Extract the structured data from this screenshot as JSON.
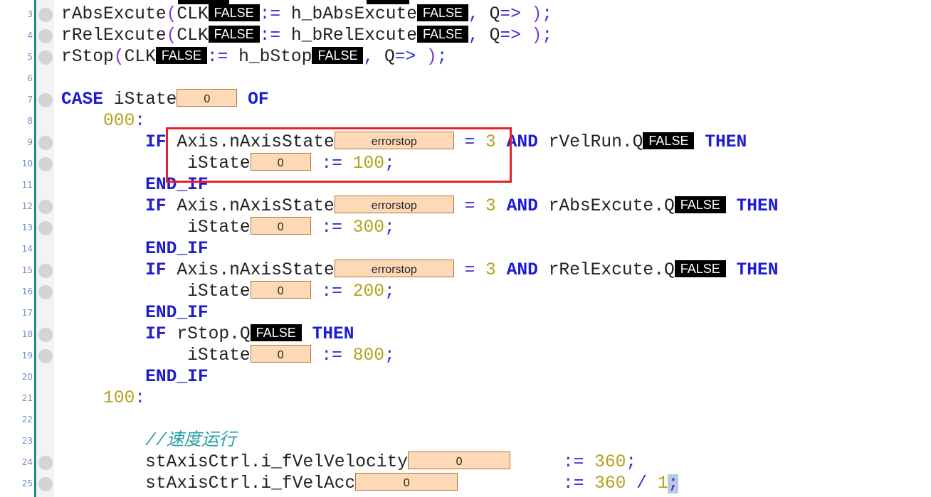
{
  "editor": {
    "colors": {
      "keyword": "#1c1cd0",
      "number": "#b5a21a",
      "comment": "#2a9fa6",
      "bool_monitor": "#000000",
      "value_monitor": "#fdd9b6",
      "highlight": "#e52129"
    },
    "highlight_lines": [
      9,
      10
    ],
    "lines": [
      {
        "n": "3",
        "bp": true,
        "seg": [
          [
            "id",
            "rAbsExcute"
          ],
          [
            "par",
            "("
          ],
          [
            "id",
            "CLK"
          ],
          [
            "mon-b",
            "FALSE"
          ],
          [
            "op",
            ":="
          ],
          [
            "id",
            " h_bAbsExcute"
          ],
          [
            "mon-b",
            "FALSE"
          ],
          [
            "op",
            ", "
          ],
          [
            "id",
            "Q"
          ],
          [
            "op",
            "=> "
          ],
          [
            "par",
            ")"
          ],
          [
            "op",
            ";"
          ]
        ]
      },
      {
        "n": "4",
        "bp": true,
        "seg": [
          [
            "id",
            "rRelExcute"
          ],
          [
            "par",
            "("
          ],
          [
            "id",
            "CLK"
          ],
          [
            "mon-b",
            "FALSE"
          ],
          [
            "op",
            ":="
          ],
          [
            "id",
            " h_bRelExcute"
          ],
          [
            "mon-b",
            "FALSE"
          ],
          [
            "op",
            ", "
          ],
          [
            "id",
            "Q"
          ],
          [
            "op",
            "=> "
          ],
          [
            "par",
            ")"
          ],
          [
            "op",
            ";"
          ]
        ]
      },
      {
        "n": "5",
        "bp": true,
        "seg": [
          [
            "id",
            "rStop"
          ],
          [
            "par",
            "("
          ],
          [
            "id",
            "CLK"
          ],
          [
            "mon-b",
            "FALSE"
          ],
          [
            "op",
            ":="
          ],
          [
            "id",
            " h_bStop"
          ],
          [
            "mon-b",
            "FALSE"
          ],
          [
            "op",
            ", "
          ],
          [
            "id",
            "Q"
          ],
          [
            "op",
            "=> "
          ],
          [
            "par",
            ")"
          ],
          [
            "op",
            ";"
          ]
        ]
      },
      {
        "n": "6",
        "bp": false,
        "seg": []
      },
      {
        "n": "7",
        "bp": true,
        "seg": [
          [
            "kw",
            "CASE"
          ],
          [
            "id",
            " iState"
          ],
          [
            "mon-v",
            "0"
          ],
          [
            "id",
            " "
          ],
          [
            "kw",
            "OF"
          ]
        ]
      },
      {
        "n": "8",
        "bp": false,
        "seg": [
          [
            "id",
            "    "
          ],
          [
            "num",
            "000"
          ],
          [
            "op",
            ":"
          ]
        ]
      },
      {
        "n": "9",
        "bp": true,
        "seg": [
          [
            "id",
            "        "
          ],
          [
            "kw",
            "IF"
          ],
          [
            "id",
            " Axis.nAxisState"
          ],
          [
            "mon-v",
            "errorstop"
          ],
          [
            "op",
            " = "
          ],
          [
            "num",
            "3"
          ],
          [
            "id",
            " "
          ],
          [
            "kw",
            "AND"
          ],
          [
            "id",
            " rVelRun.Q"
          ],
          [
            "mon-b",
            "FALSE"
          ],
          [
            "id",
            " "
          ],
          [
            "kw",
            "THEN"
          ]
        ]
      },
      {
        "n": "10",
        "bp": true,
        "seg": [
          [
            "id",
            "            iState"
          ],
          [
            "mon-v",
            "0"
          ],
          [
            "op",
            " := "
          ],
          [
            "num",
            "100"
          ],
          [
            "op",
            ";"
          ]
        ]
      },
      {
        "n": "11",
        "bp": false,
        "seg": [
          [
            "id",
            "        "
          ],
          [
            "kw",
            "END_IF"
          ]
        ]
      },
      {
        "n": "12",
        "bp": true,
        "seg": [
          [
            "id",
            "        "
          ],
          [
            "kw",
            "IF"
          ],
          [
            "id",
            " Axis.nAxisState"
          ],
          [
            "mon-v",
            "errorstop"
          ],
          [
            "op",
            " = "
          ],
          [
            "num",
            "3"
          ],
          [
            "id",
            " "
          ],
          [
            "kw",
            "AND"
          ],
          [
            "id",
            " rAbsExcute.Q"
          ],
          [
            "mon-b",
            "FALSE"
          ],
          [
            "id",
            " "
          ],
          [
            "kw",
            "THEN"
          ]
        ]
      },
      {
        "n": "13",
        "bp": true,
        "seg": [
          [
            "id",
            "            iState"
          ],
          [
            "mon-v",
            "0"
          ],
          [
            "op",
            " := "
          ],
          [
            "num",
            "300"
          ],
          [
            "op",
            ";"
          ]
        ]
      },
      {
        "n": "14",
        "bp": false,
        "seg": [
          [
            "id",
            "        "
          ],
          [
            "kw",
            "END_IF"
          ]
        ]
      },
      {
        "n": "15",
        "bp": true,
        "seg": [
          [
            "id",
            "        "
          ],
          [
            "kw",
            "IF"
          ],
          [
            "id",
            " Axis.nAxisState"
          ],
          [
            "mon-v",
            "errorstop"
          ],
          [
            "op",
            " = "
          ],
          [
            "num",
            "3"
          ],
          [
            "id",
            " "
          ],
          [
            "kw",
            "AND"
          ],
          [
            "id",
            " rRelExcute.Q"
          ],
          [
            "mon-b",
            "FALSE"
          ],
          [
            "id",
            " "
          ],
          [
            "kw",
            "THEN"
          ]
        ]
      },
      {
        "n": "16",
        "bp": true,
        "seg": [
          [
            "id",
            "            iState"
          ],
          [
            "mon-v",
            "0"
          ],
          [
            "op",
            " := "
          ],
          [
            "num",
            "200"
          ],
          [
            "op",
            ";"
          ]
        ]
      },
      {
        "n": "17",
        "bp": false,
        "seg": [
          [
            "id",
            "        "
          ],
          [
            "kw",
            "END_IF"
          ]
        ]
      },
      {
        "n": "18",
        "bp": true,
        "seg": [
          [
            "id",
            "        "
          ],
          [
            "kw",
            "IF"
          ],
          [
            "id",
            " rStop.Q"
          ],
          [
            "mon-b",
            "FALSE"
          ],
          [
            "id",
            " "
          ],
          [
            "kw",
            "THEN"
          ]
        ]
      },
      {
        "n": "19",
        "bp": true,
        "seg": [
          [
            "id",
            "            iState"
          ],
          [
            "mon-v",
            "0"
          ],
          [
            "op",
            " := "
          ],
          [
            "num",
            "800"
          ],
          [
            "op",
            ";"
          ]
        ]
      },
      {
        "n": "20",
        "bp": false,
        "seg": [
          [
            "id",
            "        "
          ],
          [
            "kw",
            "END_IF"
          ]
        ]
      },
      {
        "n": "21",
        "bp": false,
        "seg": [
          [
            "id",
            "    "
          ],
          [
            "num",
            "100"
          ],
          [
            "op",
            ":"
          ]
        ]
      },
      {
        "n": "22",
        "bp": false,
        "seg": []
      },
      {
        "n": "23",
        "bp": false,
        "seg": [
          [
            "id",
            "        "
          ],
          [
            "com",
            "//速度运行"
          ]
        ]
      },
      {
        "n": "24",
        "bp": true,
        "seg": [
          [
            "id",
            "        stAxisCtrl.i_fVelVelocity"
          ],
          [
            "mon-v",
            "0"
          ],
          [
            "id",
            "     "
          ],
          [
            "op",
            ":= "
          ],
          [
            "num",
            "360"
          ],
          [
            "op",
            ";"
          ]
        ]
      },
      {
        "n": "25",
        "bp": true,
        "seg": [
          [
            "id",
            "        stAxisCtrl.i_fVelAcc"
          ],
          [
            "mon-v",
            "0"
          ],
          [
            "id",
            "          "
          ],
          [
            "op",
            ":= "
          ],
          [
            "num",
            "360"
          ],
          [
            "op",
            " / "
          ],
          [
            "num",
            "1"
          ],
          [
            "sel",
            ";"
          ]
        ]
      }
    ]
  }
}
